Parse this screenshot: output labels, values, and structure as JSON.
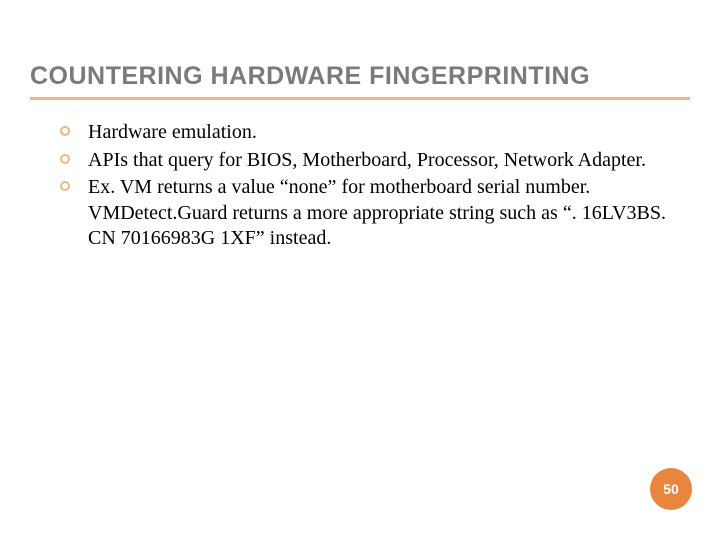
{
  "title": "COUNTERING HARDWARE FINGERPRINTING",
  "bullets": [
    "Hardware emulation.",
    "APIs that query for BIOS, Motherboard, Processor, Network Adapter.",
    "Ex. VM returns a value “none” for motherboard serial number. VMDetect.Guard returns a more appropriate string such as “. 16LV3BS. CN 70166983G 1XF” instead."
  ],
  "page_number": "50"
}
